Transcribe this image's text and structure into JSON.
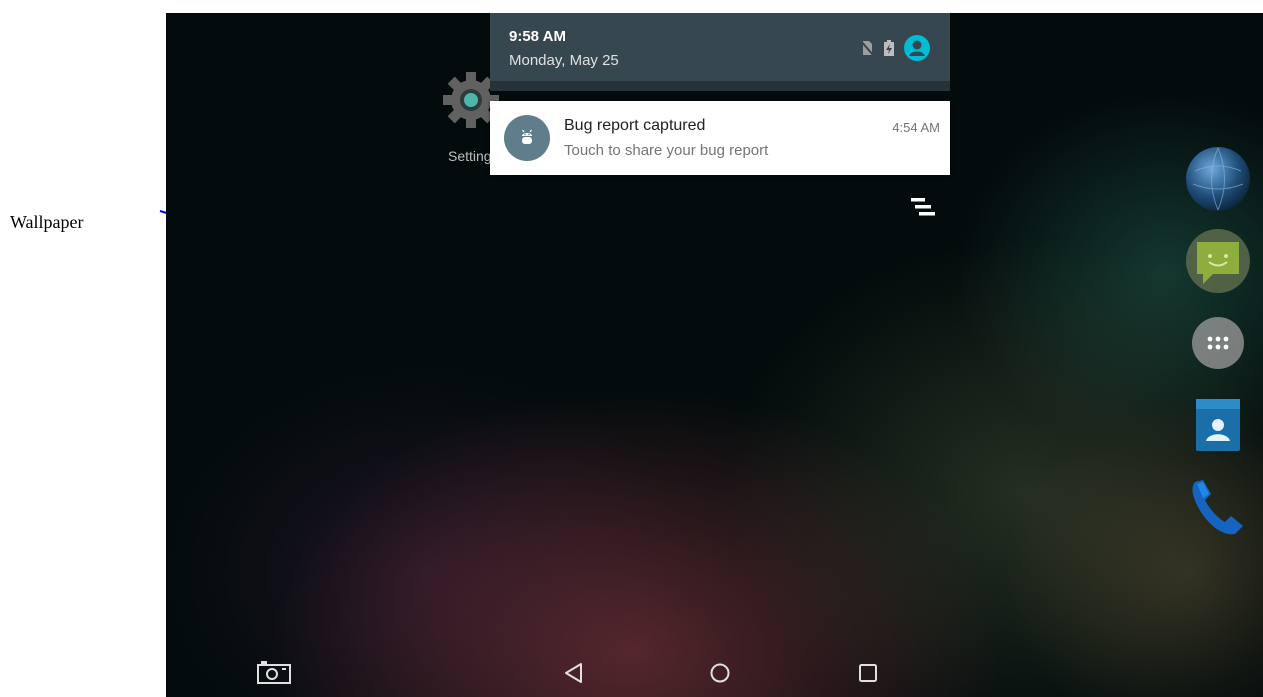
{
  "annotation": {
    "label": "Wallpaper"
  },
  "home": {
    "settings_app_label": "Settings"
  },
  "notification_shade": {
    "time": "9:58 AM",
    "date": "Monday, May 25",
    "status_icons": [
      "no-sim-icon",
      "battery-charging-icon",
      "account-icon"
    ],
    "notifications": [
      {
        "icon": "android-bug-icon",
        "title": "Bug report captured",
        "text": "Touch to share your bug report",
        "time": "4:54 AM"
      }
    ],
    "clear_all_icon": "clear-all-icon"
  },
  "dock": {
    "items": [
      "browser-icon",
      "messaging-icon",
      "app-drawer-icon",
      "contacts-icon",
      "phone-icon"
    ]
  },
  "navbar": {
    "buttons": [
      "screenshot-icon",
      "back-icon",
      "home-icon",
      "recents-icon"
    ]
  },
  "colors": {
    "shade_header": "#37474f",
    "notification_icon_bg": "#607d8b",
    "account_accent": "#00bcd4",
    "annotation_line": "#0000ee"
  }
}
